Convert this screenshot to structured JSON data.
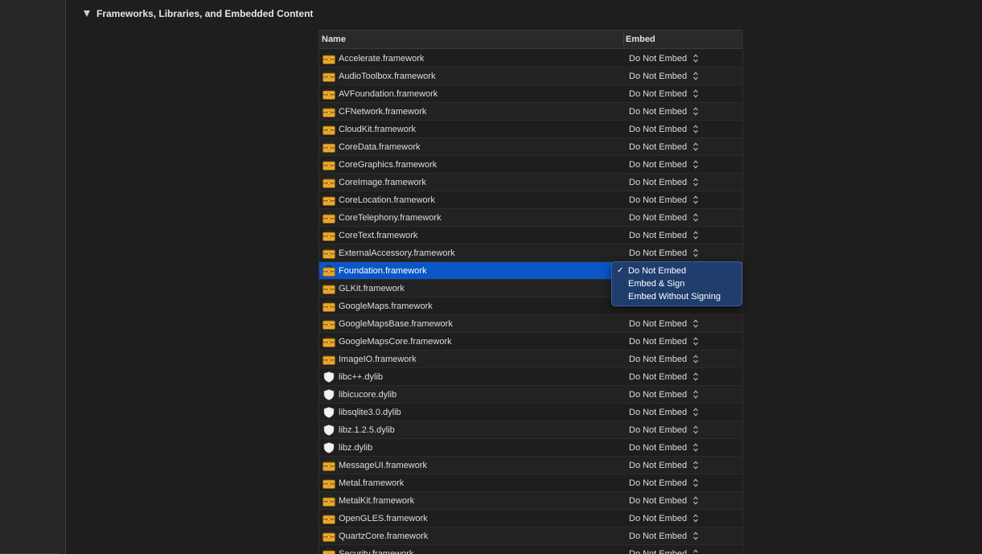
{
  "section": {
    "title": "Frameworks, Libraries, and Embedded Content"
  },
  "table": {
    "columns": {
      "name": "Name",
      "embed": "Embed"
    },
    "rows": [
      {
        "name": "Accelerate.framework",
        "embed": "Do Not Embed",
        "icon": "toolbox-icon"
      },
      {
        "name": "AudioToolbox.framework",
        "embed": "Do Not Embed",
        "icon": "toolbox-icon"
      },
      {
        "name": "AVFoundation.framework",
        "embed": "Do Not Embed",
        "icon": "toolbox-icon"
      },
      {
        "name": "CFNetwork.framework",
        "embed": "Do Not Embed",
        "icon": "toolbox-icon"
      },
      {
        "name": "CloudKit.framework",
        "embed": "Do Not Embed",
        "icon": "toolbox-icon"
      },
      {
        "name": "CoreData.framework",
        "embed": "Do Not Embed",
        "icon": "toolbox-icon"
      },
      {
        "name": "CoreGraphics.framework",
        "embed": "Do Not Embed",
        "icon": "toolbox-icon"
      },
      {
        "name": "CoreImage.framework",
        "embed": "Do Not Embed",
        "icon": "toolbox-icon"
      },
      {
        "name": "CoreLocation.framework",
        "embed": "Do Not Embed",
        "icon": "toolbox-icon"
      },
      {
        "name": "CoreTelephony.framework",
        "embed": "Do Not Embed",
        "icon": "toolbox-icon"
      },
      {
        "name": "CoreText.framework",
        "embed": "Do Not Embed",
        "icon": "toolbox-icon"
      },
      {
        "name": "ExternalAccessory.framework",
        "embed": "Do Not Embed",
        "icon": "toolbox-icon"
      },
      {
        "name": "Foundation.framework",
        "embed": "",
        "icon": "toolbox-icon",
        "selected": true
      },
      {
        "name": "GLKit.framework",
        "embed": "",
        "icon": "toolbox-icon"
      },
      {
        "name": "GoogleMaps.framework",
        "embed": "",
        "icon": "toolbox-icon"
      },
      {
        "name": "GoogleMapsBase.framework",
        "embed": "Do Not Embed",
        "icon": "toolbox-icon"
      },
      {
        "name": "GoogleMapsCore.framework",
        "embed": "Do Not Embed",
        "icon": "toolbox-icon"
      },
      {
        "name": "ImageIO.framework",
        "embed": "Do Not Embed",
        "icon": "toolbox-icon"
      },
      {
        "name": "libc++.dylib",
        "embed": "Do Not Embed",
        "icon": "shield-icon"
      },
      {
        "name": "libicucore.dylib",
        "embed": "Do Not Embed",
        "icon": "shield-icon"
      },
      {
        "name": "libsqlite3.0.dylib",
        "embed": "Do Not Embed",
        "icon": "shield-icon"
      },
      {
        "name": "libz.1.2.5.dylib",
        "embed": "Do Not Embed",
        "icon": "shield-icon"
      },
      {
        "name": "libz.dylib",
        "embed": "Do Not Embed",
        "icon": "shield-icon"
      },
      {
        "name": "MessageUI.framework",
        "embed": "Do Not Embed",
        "icon": "toolbox-icon"
      },
      {
        "name": "Metal.framework",
        "embed": "Do Not Embed",
        "icon": "toolbox-icon"
      },
      {
        "name": "MetalKit.framework",
        "embed": "Do Not Embed",
        "icon": "toolbox-icon"
      },
      {
        "name": "OpenGLES.framework",
        "embed": "Do Not Embed",
        "icon": "toolbox-icon"
      },
      {
        "name": "QuartzCore.framework",
        "embed": "Do Not Embed",
        "icon": "toolbox-icon"
      },
      {
        "name": "Security.framework",
        "embed": "Do Not Embed",
        "icon": "toolbox-icon"
      }
    ]
  },
  "embed_menu": {
    "options": [
      "Do Not Embed",
      "Embed & Sign",
      "Embed Without Signing"
    ],
    "selected": "Do Not Embed",
    "check_glyph": "✓"
  },
  "colors": {
    "selection": "#0a56c7",
    "menu_background": "#1f3e6e",
    "toolbox_icon": "#e8a92b"
  }
}
